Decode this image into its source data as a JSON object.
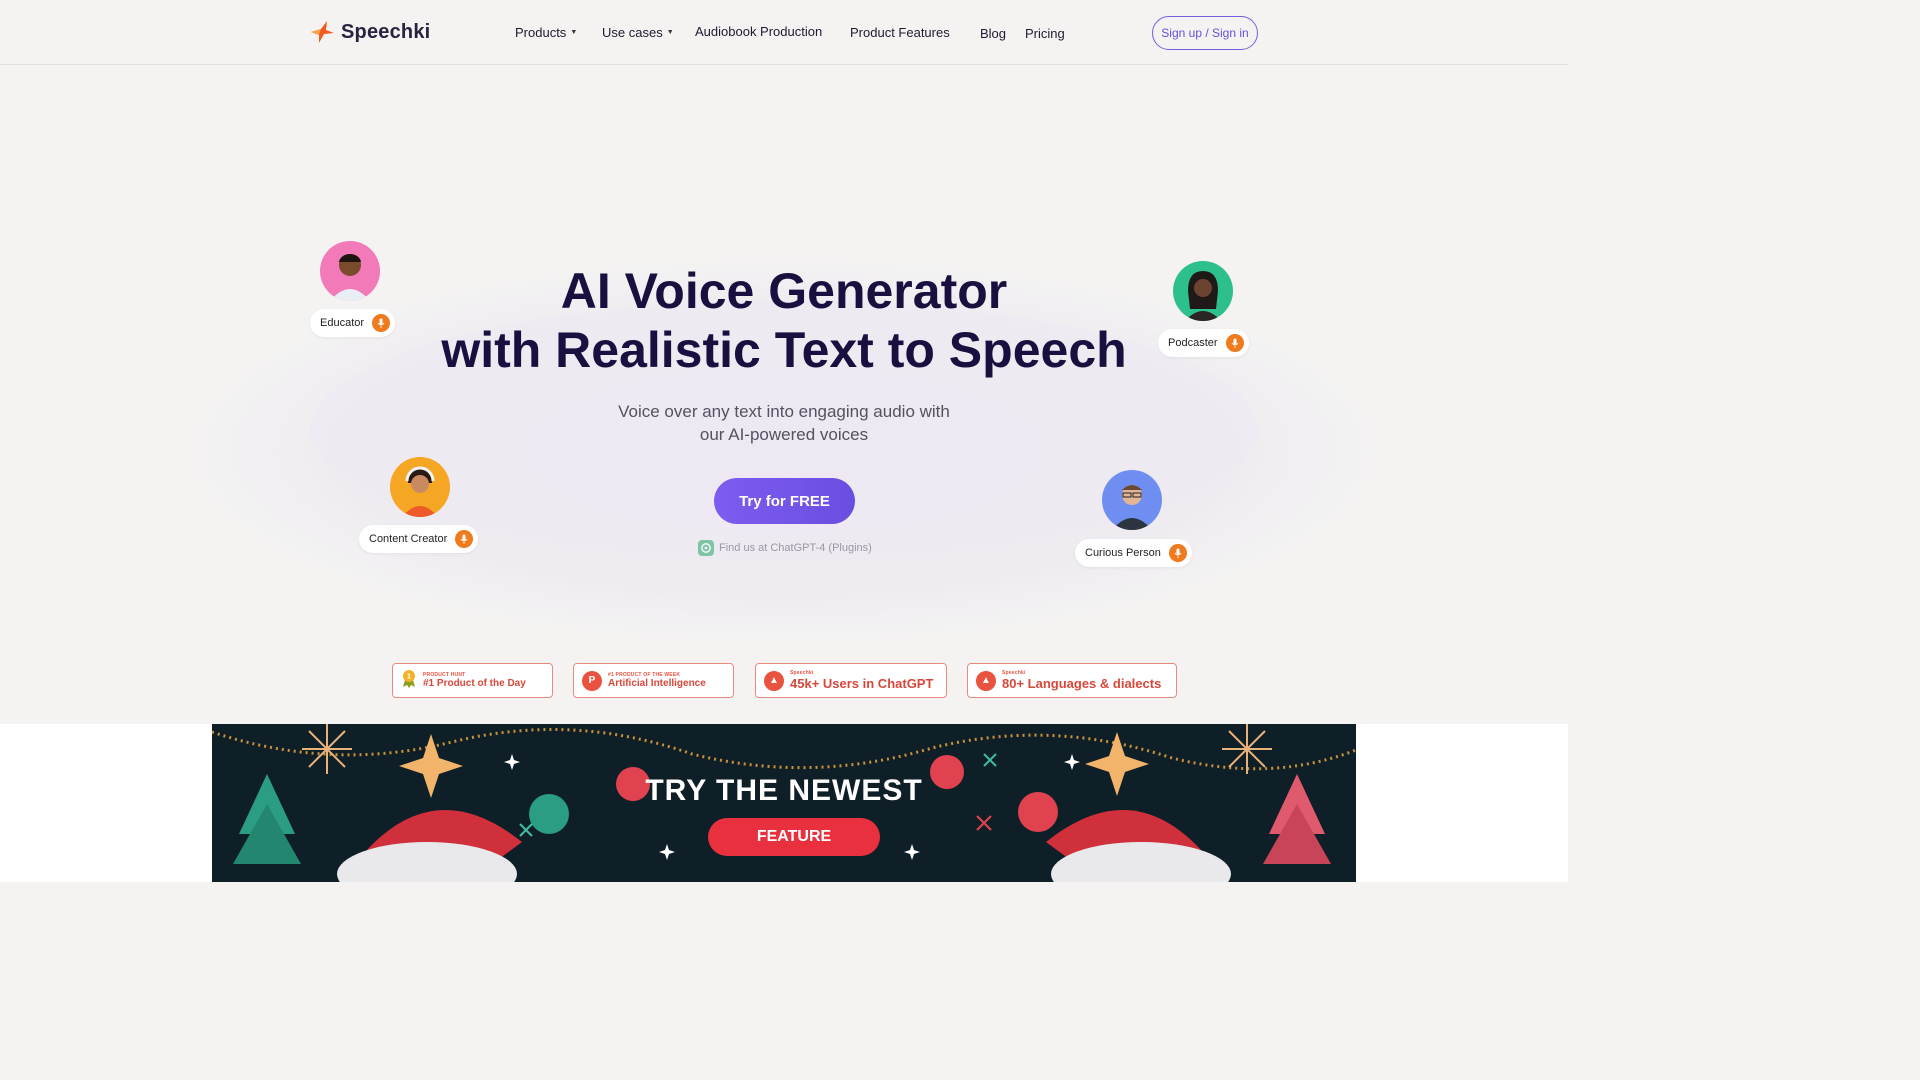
{
  "brand": {
    "name": "Speechki",
    "accent": "#f05a1e",
    "primary": "#7a5ce0"
  },
  "nav": {
    "items": [
      {
        "label": "Products",
        "has_caret": true
      },
      {
        "label": "Use cases",
        "has_caret": true
      },
      {
        "label": "Audiobook Production",
        "has_caret": false
      },
      {
        "label": "Product Features",
        "has_caret": false
      },
      {
        "label": "Blog",
        "has_caret": false
      },
      {
        "label": "Pricing",
        "has_caret": false
      }
    ],
    "signin_label": "Sign up / Sign in"
  },
  "hero": {
    "title_line1": "AI Voice Generator",
    "title_line2": "with Realistic Text to Speech",
    "subtitle_line1": "Voice over any text into engaging audio with",
    "subtitle_line2": "our AI-powered voices",
    "cta_label": "Try for FREE",
    "chatgpt_text": "Find us at ChatGPT-4 (Plugins)"
  },
  "personas": [
    {
      "label": "Educator",
      "avatar_color": "#f27ab8"
    },
    {
      "label": "Podcaster",
      "avatar_color": "#2dbf8c"
    },
    {
      "label": "Content Creator",
      "avatar_color": "#f5a623"
    },
    {
      "label": "Curious Person",
      "avatar_color": "#6f8ef2"
    }
  ],
  "badges": [
    {
      "small": "PRODUCT HUNT",
      "big": "#1 Product of the Day",
      "icon": "medal-icon"
    },
    {
      "small": "#1 PRODUCT OF THE WEEK",
      "big": "Artificial Intelligence",
      "icon": "product-hunt-icon"
    },
    {
      "small": "Speechki",
      "big": "45k+ Users in ChatGPT",
      "icon": "speechki-badge-icon"
    },
    {
      "small": "Speechki",
      "big": "80+ Languages & dialects",
      "icon": "speechki-badge-icon"
    }
  ],
  "banner": {
    "title": "TRY THE  NEWEST",
    "pill_label": "FEATURE"
  }
}
